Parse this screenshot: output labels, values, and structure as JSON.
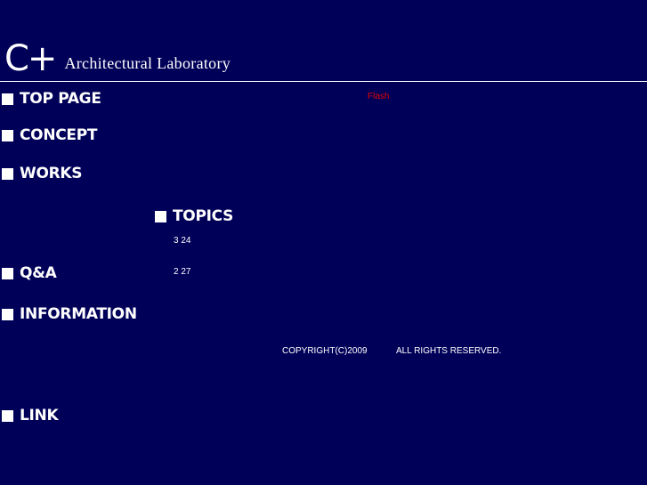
{
  "header": {
    "logo_mark": "C+",
    "logo_text": "Architectural Laboratory"
  },
  "nav": {
    "top_page": "TOP PAGE",
    "concept": "CONCEPT",
    "works": "WORKS",
    "topics": "TOPICS",
    "qa": "Q&A",
    "information": "INFORMATION",
    "link": "LINK"
  },
  "flash_notice": "Flash",
  "topics_list": [
    {
      "date": "3 24"
    },
    {
      "date": "2 27"
    }
  ],
  "footer": {
    "copyright": "COPYRIGHT(C)2009",
    "rights": "ALL RIGHTS RESERVED."
  },
  "colors": {
    "background": "#000059",
    "text": "#ffffff",
    "flash_text": "#e00000"
  }
}
